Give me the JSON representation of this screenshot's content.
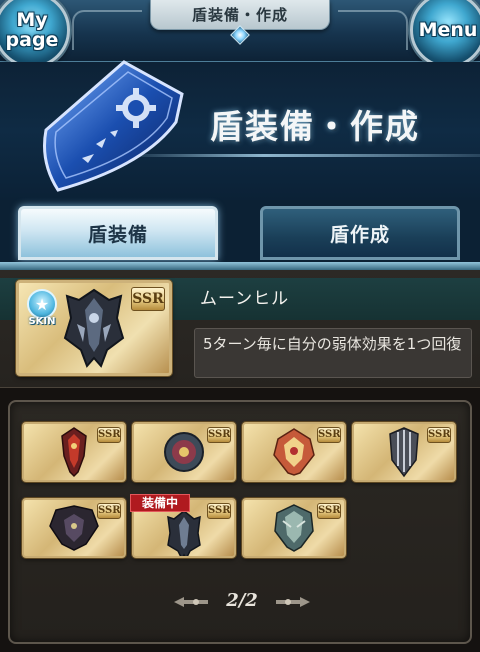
{
  "header": {
    "title": "盾装備・作成",
    "mypage_label": "My\npage",
    "menu_label": "Menu"
  },
  "banner": {
    "title": "盾装備・作成",
    "icon": "shield-icon"
  },
  "tabs": [
    {
      "label": "盾装備",
      "active": true
    },
    {
      "label": "盾作成",
      "active": false
    }
  ],
  "selected_shield": {
    "name": "ムーンヒル",
    "rarity": "SSR",
    "skin_label": "SKIN",
    "description": "5ターン毎に自分の弱体効果を1つ回復"
  },
  "shield_list": {
    "items": [
      {
        "rarity": "SSR",
        "icon": "shield-icon",
        "equipped": false
      },
      {
        "rarity": "SSR",
        "icon": "shield-icon",
        "equipped": false
      },
      {
        "rarity": "SSR",
        "icon": "shield-icon",
        "equipped": false
      },
      {
        "rarity": "SSR",
        "icon": "shield-icon",
        "equipped": false
      },
      {
        "rarity": "SSR",
        "icon": "shield-icon",
        "equipped": false
      },
      {
        "rarity": "SSR",
        "icon": "shield-icon",
        "equipped": true
      },
      {
        "rarity": "SSR",
        "icon": "shield-icon",
        "equipped": false
      }
    ],
    "equipped_label": "装備中"
  },
  "pagination": {
    "text": "2/2"
  },
  "colors": {
    "accent_blue": "#1b4fb0",
    "equipped_red": "#b01a1f",
    "card_gold": "#d4b676"
  }
}
